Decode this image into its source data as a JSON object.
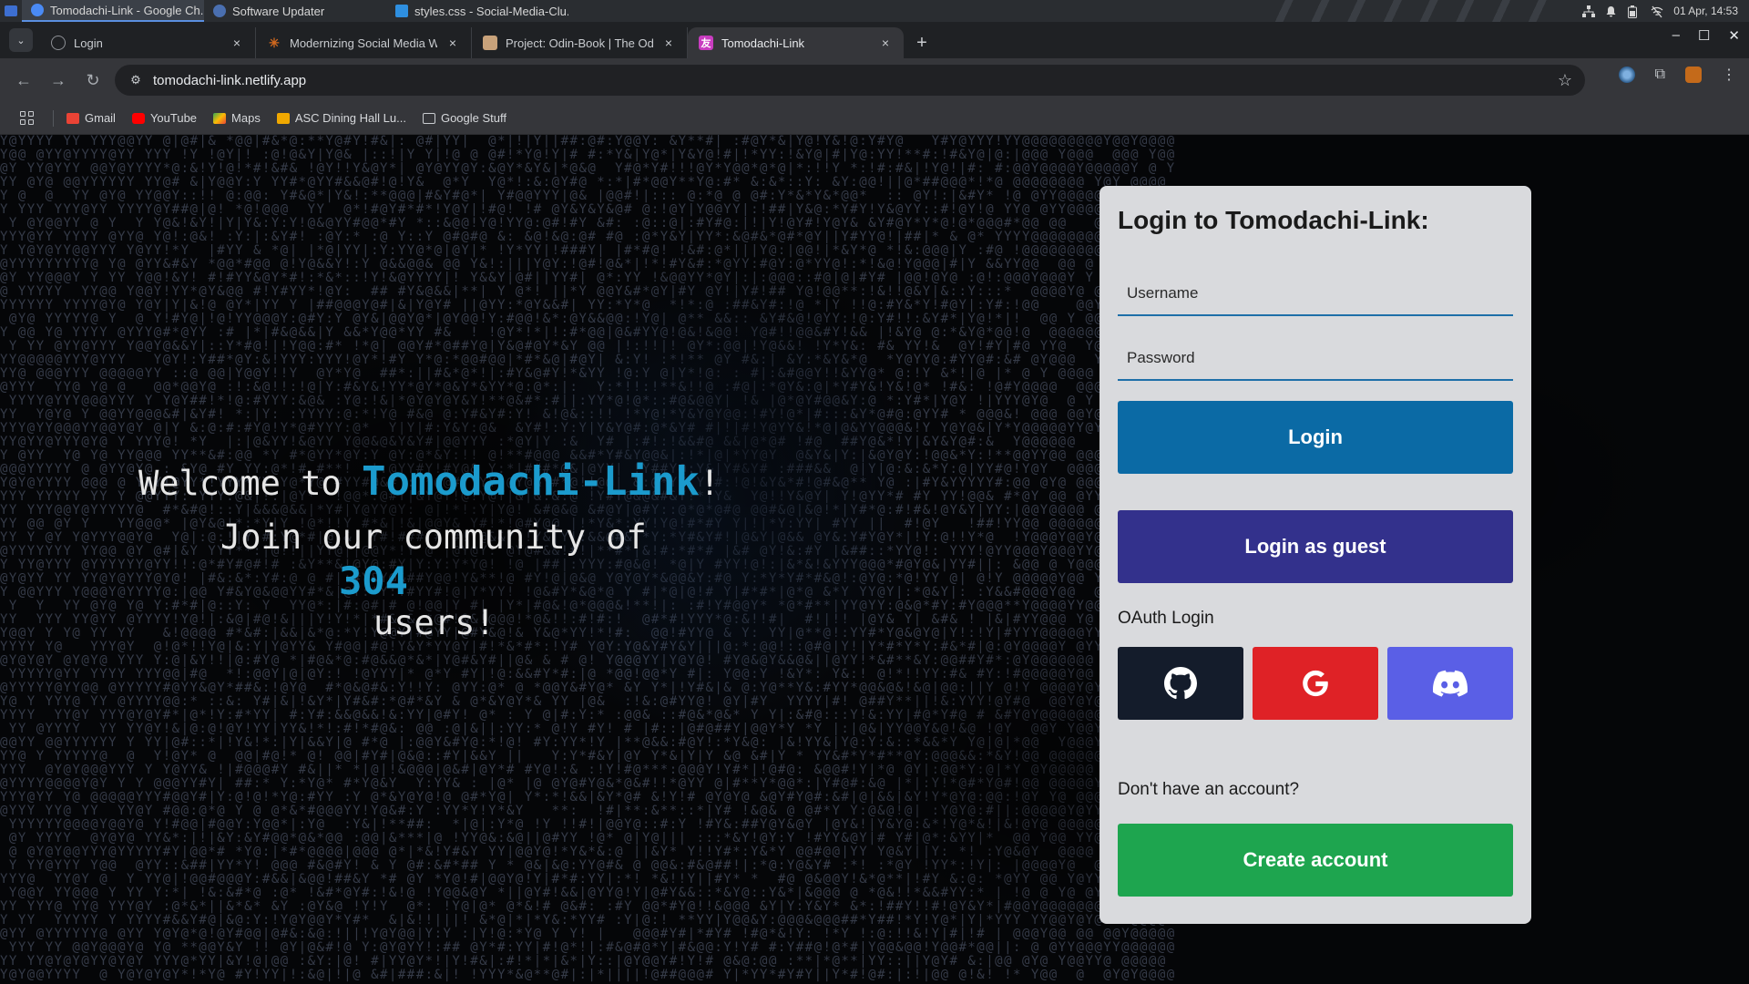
{
  "os_panel": {
    "tasks": [
      {
        "label": "Tomodachi-Link - Google Ch...",
        "icon": "chrome-icon",
        "color": "#4a8af4"
      },
      {
        "label": "Software Updater",
        "icon": "updater-icon",
        "color": "#4a6fb0"
      },
      {
        "label": "styles.css - Social-Media-Clu...",
        "icon": "vscode-icon",
        "color": "#2e8fe0"
      }
    ],
    "clock": "01 Apr, 14:53"
  },
  "browser": {
    "tabs": [
      {
        "label": "Login",
        "favicon_color": "#5f6368",
        "active": false
      },
      {
        "label": "Modernizing Social Media We",
        "favicon_color": "#d2691e",
        "active": false
      },
      {
        "label": "Project: Odin-Book | The Odin",
        "favicon_color": "#c8a27a",
        "active": false
      },
      {
        "label": "Tomodachi-Link",
        "favicon_color": "#c93dc0",
        "active": true
      }
    ],
    "url": "tomodachi-link.netlify.app",
    "bookmarks": [
      {
        "label": "Gmail",
        "color": "#ea4335"
      },
      {
        "label": "YouTube",
        "color": "#ff0000"
      },
      {
        "label": "Maps",
        "color": "#34a853"
      },
      {
        "label": "ASC Dining Hall Lu...",
        "color": "#f0a800"
      },
      {
        "label": "Google Stuff",
        "color": "#c9ccd0"
      }
    ]
  },
  "welcome": {
    "prefix": "Welcome to ",
    "brand": "Tomodachi-Link",
    "suffix": "!",
    "line2": "Join our community of",
    "user_count": "304",
    "line4": "users!",
    "accent_color": "#1b9bcd"
  },
  "login": {
    "title": "Login to Tomodachi-Link:",
    "username_placeholder": "Username",
    "password_placeholder": "Password",
    "login_button": "Login",
    "guest_button": "Login as guest",
    "oauth_label": "OAuth Login",
    "oauth_providers": [
      "github-icon",
      "google-icon",
      "discord-icon"
    ],
    "no_account_text": "Don't have an account?",
    "create_button": "Create account",
    "colors": {
      "login": "#0b6aa5",
      "guest": "#33318c",
      "github": "#141c2b",
      "google": "#df2226",
      "discord": "#5a5fe6",
      "create": "#1ea54f"
    }
  }
}
